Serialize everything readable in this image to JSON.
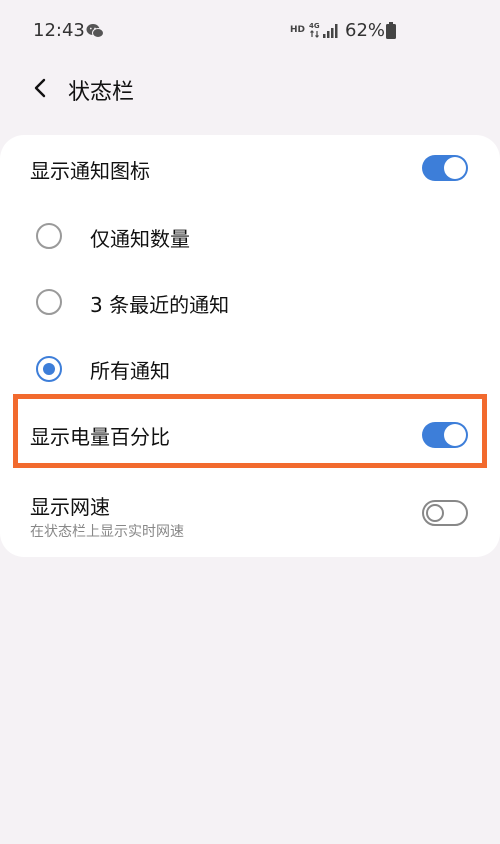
{
  "status_bar": {
    "time": "12:43",
    "hd": "HD",
    "network": "4G",
    "battery_percent": "62%",
    "icons": [
      "wechat-icon",
      "network-arrows-icon",
      "signal-icon",
      "battery-icon"
    ]
  },
  "header": {
    "back_icon": "chevron-left-icon",
    "title": "状态栏"
  },
  "settings": {
    "show_notification_icons": {
      "label": "显示通知图标",
      "enabled": true
    },
    "notification_options": [
      {
        "label": "仅通知数量",
        "selected": false
      },
      {
        "label": "3 条最近的通知",
        "selected": false
      },
      {
        "label": "所有通知",
        "selected": true
      }
    ],
    "show_battery_percentage": {
      "label": "显示电量百分比",
      "enabled": true
    },
    "show_network_speed": {
      "label": "显示网速",
      "sublabel": "在状态栏上显示实时网速",
      "enabled": false
    }
  },
  "colors": {
    "accent": "#3d7ed9",
    "highlight": "#f26a2e",
    "background": "#f5f2f5",
    "card": "#ffffff"
  }
}
